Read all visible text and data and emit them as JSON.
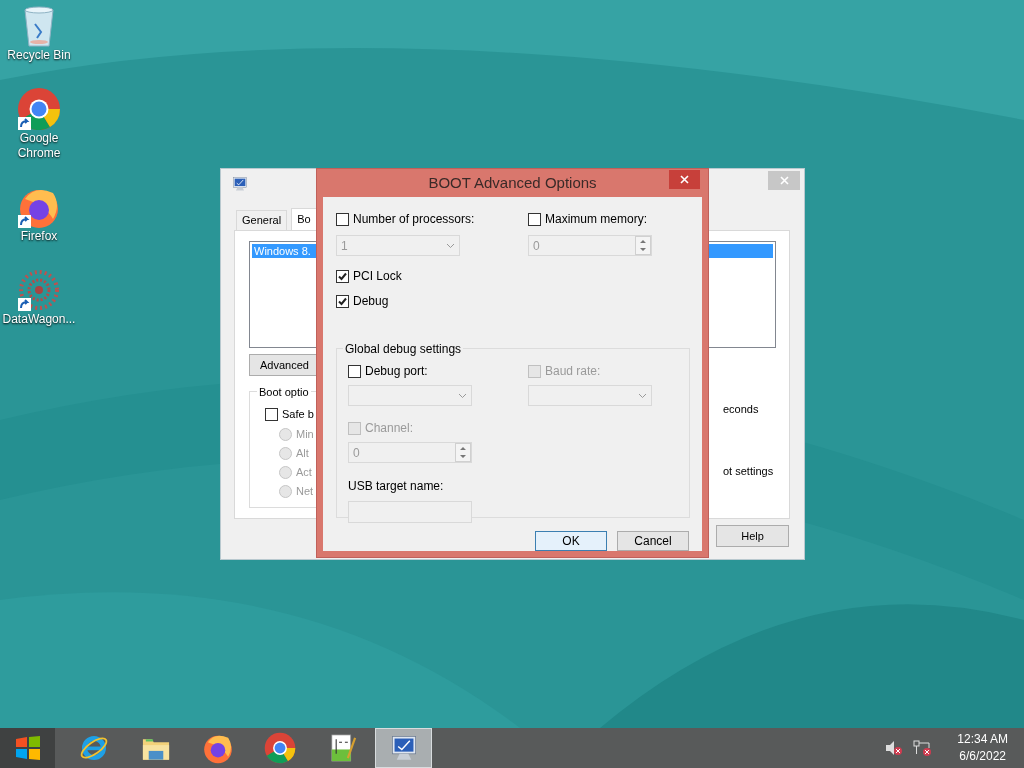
{
  "desktop_icons": [
    {
      "label": "Recycle Bin",
      "kind": "recycle",
      "shortcut": false
    },
    {
      "label": "Google Chrome",
      "kind": "chrome",
      "shortcut": true
    },
    {
      "label": "Firefox",
      "kind": "firefox",
      "shortcut": true
    },
    {
      "label": "DataWagon...",
      "kind": "datawagon",
      "shortcut": true
    }
  ],
  "back_window": {
    "tabs": [
      {
        "label": "General",
        "selected": false
      },
      {
        "label": "Bo",
        "selected": true
      }
    ],
    "list_items": [
      {
        "label": "Windows 8.",
        "selected": true
      }
    ],
    "advanced_button": "Advanced",
    "boot_options": {
      "legend": "Boot optio",
      "safe_boot": {
        "label": "Safe b",
        "checked": false
      },
      "radios": [
        {
          "label": "Min",
          "selected": false,
          "disabled": true
        },
        {
          "label": "Alt",
          "selected": false,
          "disabled": true
        },
        {
          "label": "Act",
          "selected": false,
          "disabled": true
        },
        {
          "label": "Net",
          "selected": false,
          "disabled": true
        }
      ]
    },
    "timeout_text": "econds",
    "boot_settings_text": "ot settings",
    "help_button": "Help"
  },
  "dialog": {
    "title": "BOOT Advanced Options",
    "processors": {
      "label": "Number of processors:",
      "checked": false,
      "field": {
        "value": "1",
        "disabled": true
      }
    },
    "max_memory": {
      "label": "Maximum memory:",
      "checked": false,
      "field": {
        "value": "0",
        "disabled": true
      }
    },
    "pci_lock": {
      "label": "PCI Lock",
      "checked": true
    },
    "debug": {
      "label": "Debug",
      "checked": true
    },
    "debug_settings": {
      "legend": "Global debug settings",
      "debug_port": {
        "label": "Debug port:",
        "checked": false,
        "disabled": false
      },
      "baud_rate": {
        "label": "Baud rate:",
        "checked": false,
        "disabled": true
      },
      "channel": {
        "label": "Channel:",
        "checked": false,
        "disabled": true,
        "field": {
          "value": "0",
          "disabled": true
        }
      },
      "usb_target": {
        "label": "USB target name:"
      }
    },
    "buttons": [
      {
        "label": "OK",
        "default": true
      },
      {
        "label": "Cancel",
        "default": false
      }
    ]
  },
  "taskbar": {
    "items": [
      {
        "kind": "ie",
        "active": false
      },
      {
        "kind": "explorer",
        "active": false
      },
      {
        "kind": "firefox",
        "active": false
      },
      {
        "kind": "chrome",
        "active": false
      },
      {
        "kind": "notepad",
        "active": false
      },
      {
        "kind": "sysconfig",
        "active": true
      }
    ],
    "time": "12:34 AM",
    "date": "6/6/2022"
  }
}
